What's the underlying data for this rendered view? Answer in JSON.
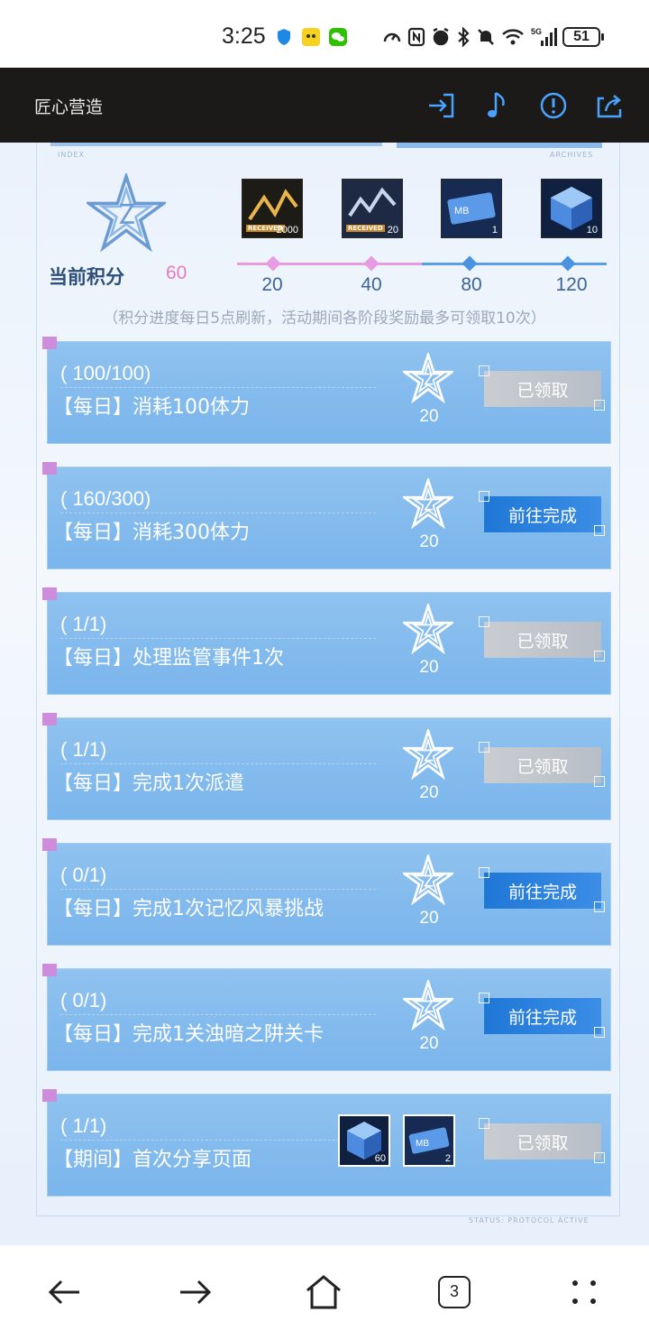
{
  "status_bar": {
    "time": "3:25",
    "battery": "51",
    "network": "5G"
  },
  "header": {
    "title": "匠心营造",
    "icons": [
      "login-icon",
      "music-note-icon",
      "alert-icon",
      "share-icon"
    ]
  },
  "panel": {
    "index_label": "INDEX",
    "archives_label": "ARCHIVES",
    "status_label": "STATUS: PROTOCOL ACTIVE"
  },
  "milestone_rewards": [
    {
      "icon": "gold-material-icon",
      "badge": "RECEIVED",
      "count": "2000"
    },
    {
      "icon": "silver-material-icon",
      "badge": "RECEIVED",
      "count": "20"
    },
    {
      "icon": "ticket-icon",
      "badge": "",
      "count": "1"
    },
    {
      "icon": "crystal-cube-icon",
      "badge": "",
      "count": "10"
    }
  ],
  "score": {
    "label": "当前积分",
    "value": "60",
    "progress_fraction": 0.5
  },
  "milestones": [
    "20",
    "40",
    "80",
    "120"
  ],
  "note": "（积分进度每日5点刷新，活动期间各阶段奖励最多可领取10次）",
  "tasks": [
    {
      "progress": "( 100/100)",
      "name": "【每日】消耗100体力",
      "points": "20",
      "button": "已领取",
      "state": "claimed"
    },
    {
      "progress": "( 160/300)",
      "name": "【每日】消耗300体力",
      "points": "20",
      "button": "前往完成",
      "state": "goto"
    },
    {
      "progress": "( 1/1)",
      "name": "【每日】处理监管事件1次",
      "points": "20",
      "button": "已领取",
      "state": "claimed"
    },
    {
      "progress": "( 1/1)",
      "name": "【每日】完成1次派遣",
      "points": "20",
      "button": "已领取",
      "state": "claimed"
    },
    {
      "progress": "( 0/1)",
      "name": "【每日】完成1次记忆风暴挑战",
      "points": "20",
      "button": "前往完成",
      "state": "goto"
    },
    {
      "progress": "( 0/1)",
      "name": "【每日】完成1关浊暗之阱关卡",
      "points": "20",
      "button": "前往完成",
      "state": "goto"
    },
    {
      "progress": "( 1/1)",
      "name": "【期间】首次分享页面",
      "points": "",
      "button": "已领取",
      "state": "claimed",
      "rewards": [
        {
          "icon": "crystal-cube-icon",
          "count": "60"
        },
        {
          "icon": "ticket-icon",
          "count": "2"
        }
      ]
    }
  ],
  "nav": {
    "tab_count": "3",
    "icons": [
      "back-arrow-icon",
      "forward-arrow-icon",
      "home-icon",
      "tabs-icon",
      "menu-dots-icon"
    ]
  },
  "colors": {
    "header_bg": "#1b1a18",
    "card_blue": "#7ab5ec",
    "score_pink": "#e77bbf",
    "goto_button": "#1f77d6",
    "claimed_button": "#c0c5cc"
  }
}
